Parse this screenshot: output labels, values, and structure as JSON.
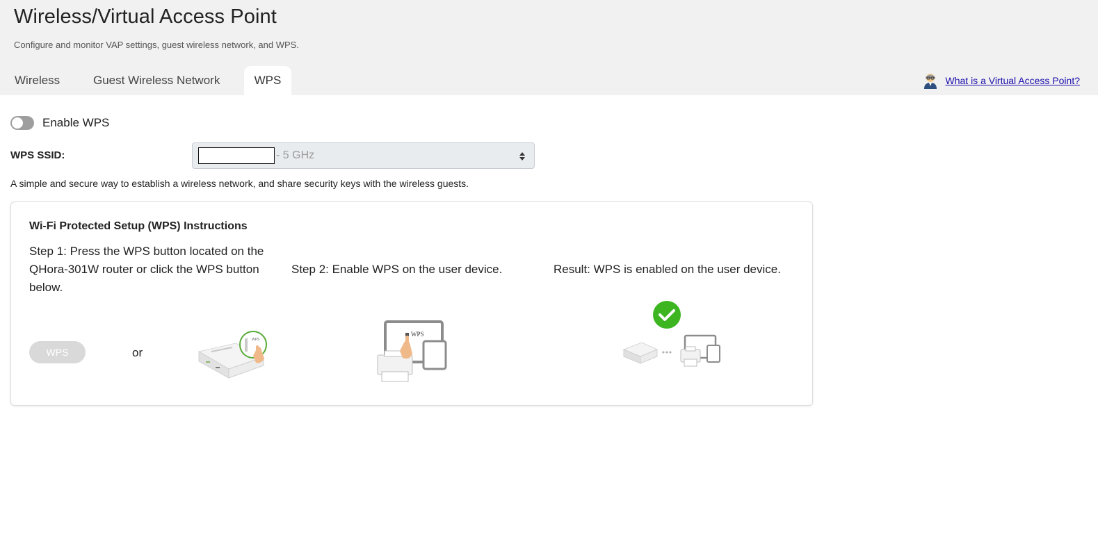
{
  "header": {
    "title": "Wireless/Virtual Access Point",
    "subtitle": "Configure and monitor VAP settings, guest wireless network, and WPS."
  },
  "tabs": [
    {
      "label": "Wireless",
      "active": false
    },
    {
      "label": "Guest Wireless Network",
      "active": false
    },
    {
      "label": "WPS",
      "active": true
    }
  ],
  "help": {
    "link_text": "What is a Virtual Access Point?",
    "icon": "assistant-avatar-icon"
  },
  "wps": {
    "enable_label": "Enable WPS",
    "enabled": false,
    "ssid_label": "WPS SSID:",
    "ssid_value_suffix": "- 5 GHz",
    "description": "A simple and secure way to establish a wireless network, and share security keys with the wireless guests."
  },
  "instructions": {
    "title": "Wi-Fi Protected Setup (WPS) Instructions",
    "step1": "Step 1: Press the WPS button located on the QHora-301W router or click the WPS button below.",
    "step2": "Step 2: Enable WPS on the user device.",
    "result": "Result: WPS is enabled on the user device.",
    "wps_button_label": "WPS",
    "or_text": "or",
    "device_screen_label": "WPS"
  },
  "colors": {
    "header_bg": "#f1f1f1",
    "link": "#1a0dab",
    "toggle_off": "#9e9e9e",
    "success_green": "#3cb521",
    "router_ring": "#5aab3a"
  }
}
